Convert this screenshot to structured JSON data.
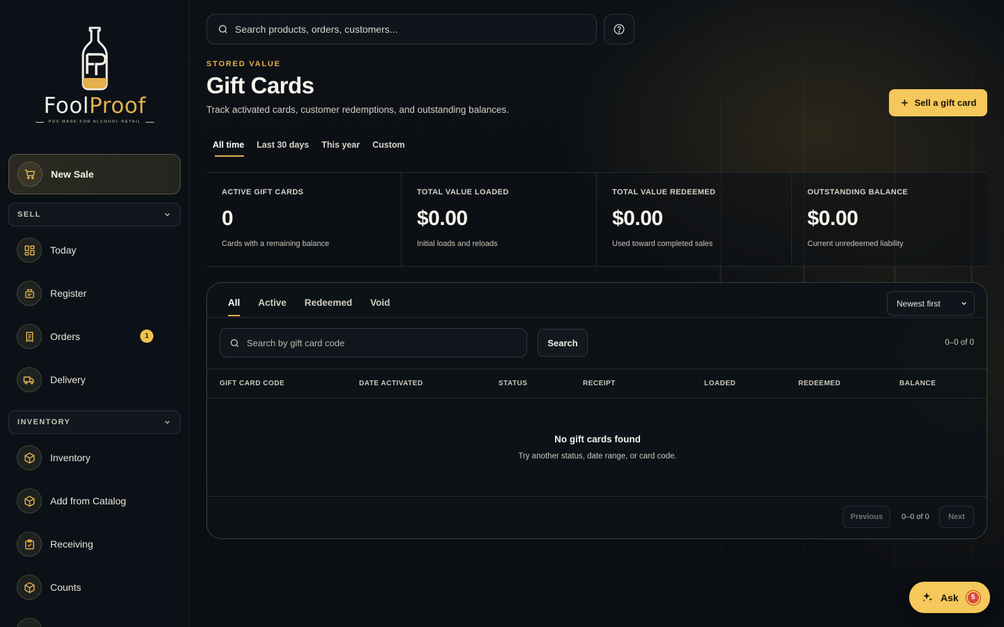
{
  "brand": {
    "name_prefix": "Fool",
    "name_suffix": "Proof",
    "tagline": "POS MADE FOR ALCOHOL RETAIL",
    "accent_color": "#e3b04b"
  },
  "sidebar": {
    "new_sale": {
      "label": "New Sale",
      "icon": "cart-icon"
    },
    "sections": [
      {
        "title": "SELL",
        "items": [
          {
            "label": "Today",
            "icon": "dashboard-icon"
          },
          {
            "label": "Register",
            "icon": "register-icon"
          },
          {
            "label": "Orders",
            "icon": "receipt-icon",
            "badge": "1"
          },
          {
            "label": "Delivery",
            "icon": "truck-icon"
          }
        ]
      },
      {
        "title": "INVENTORY",
        "items": [
          {
            "label": "Inventory",
            "icon": "box-icon"
          },
          {
            "label": "Add from Catalog",
            "icon": "box-icon"
          },
          {
            "label": "Receiving",
            "icon": "clipboard-check-icon"
          },
          {
            "label": "Counts",
            "icon": "box-icon"
          }
        ]
      }
    ]
  },
  "header": {
    "search_placeholder": "Search products, orders, customers...",
    "help_icon": "help-icon"
  },
  "page": {
    "eyebrow": "STORED VALUE",
    "title": "Gift Cards",
    "subtitle": "Track activated cards, customer redemptions, and outstanding balances.",
    "primary_action": "Sell a gift card"
  },
  "range_tabs": [
    {
      "label": "All time",
      "active": true
    },
    {
      "label": "Last 30 days",
      "active": false
    },
    {
      "label": "This year",
      "active": false
    },
    {
      "label": "Custom",
      "active": false
    }
  ],
  "stats": [
    {
      "label": "ACTIVE GIFT CARDS",
      "value": "0",
      "note": "Cards with a remaining balance"
    },
    {
      "label": "TOTAL VALUE LOADED",
      "value": "$0.00",
      "note": "Initial loads and reloads"
    },
    {
      "label": "TOTAL VALUE REDEEMED",
      "value": "$0.00",
      "note": "Used toward completed sales"
    },
    {
      "label": "OUTSTANDING BALANCE",
      "value": "$0.00",
      "note": "Current unredeemed liability"
    }
  ],
  "table": {
    "status_tabs": [
      {
        "label": "All",
        "active": true
      },
      {
        "label": "Active",
        "active": false
      },
      {
        "label": "Redeemed",
        "active": false
      },
      {
        "label": "Void",
        "active": false
      }
    ],
    "sort_value": "Newest first",
    "code_search_placeholder": "Search by gift card code",
    "search_label": "Search",
    "count_text": "0–0 of 0",
    "columns": [
      "GIFT CARD CODE",
      "DATE ACTIVATED",
      "STATUS",
      "RECEIPT",
      "LOADED",
      "REDEEMED",
      "BALANCE"
    ],
    "empty_title": "No gift cards found",
    "empty_subtitle": "Try another status, date range, or card code.",
    "pager": {
      "previous": "Previous",
      "count": "0–0 of 0",
      "next": "Next"
    }
  },
  "assistant": {
    "label": "Ask",
    "badge": "5",
    "icon": "sparkle-icon"
  }
}
